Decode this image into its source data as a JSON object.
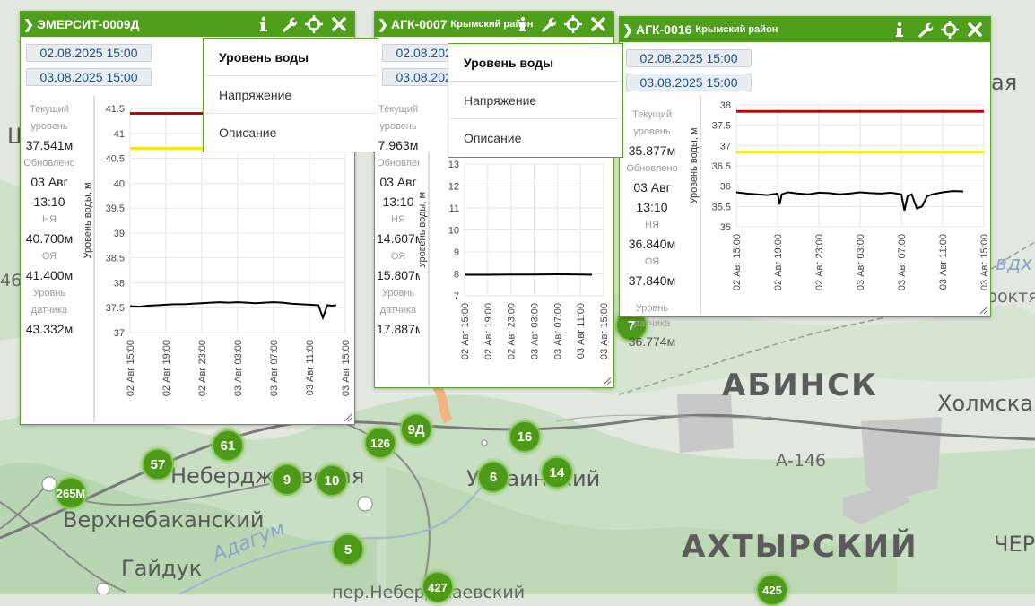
{
  "map": {
    "labels": [
      {
        "id": "abinsk",
        "text": "АБИНСК",
        "cls": "big"
      },
      {
        "id": "akhtyrsky",
        "text": "АХТЫРСКИЙ",
        "cls": "big"
      },
      {
        "id": "kholmskaya",
        "text": "Холмская",
        "cls": "mid"
      },
      {
        "id": "neberdzhaevskaya",
        "text": "Неберджаевская",
        "cls": "mid"
      },
      {
        "id": "verkhnebakansky",
        "text": "Верхнебаканский",
        "cls": "mid"
      },
      {
        "id": "gaiduk",
        "text": "Гайдук",
        "cls": "mid"
      },
      {
        "id": "adagum",
        "text": "Адагум",
        "cls": "river"
      },
      {
        "id": "a146",
        "text": "А-146",
        "cls": "road"
      },
      {
        "id": "ukrainsky",
        "text": "Украинский",
        "cls": "mid"
      },
      {
        "id": "cher",
        "text": "ЧЕР",
        "cls": "mid"
      },
      {
        "id": "proktya",
        "text": "роктя",
        "cls": "road"
      },
      {
        "id": "vdkh",
        "text": "вдх",
        "cls": "river"
      },
      {
        "id": "aya",
        "text": "ая",
        "cls": "mid"
      },
      {
        "id": "per",
        "text": "пер.Неберджаевский",
        "cls": "road"
      },
      {
        "id": "sh",
        "text": "Ш",
        "cls": "mid"
      },
      {
        "id": "num46",
        "text": "46",
        "cls": "road"
      }
    ],
    "clusters": [
      "61",
      "57",
      "9",
      "10",
      "126",
      "9Д",
      "16",
      "6",
      "14",
      "5",
      "427",
      "425",
      "265М",
      "7"
    ]
  },
  "panels": [
    {
      "id": "p1",
      "title": "ЭМЕРСИТ-0009Д",
      "subtitle": "",
      "date_from": "02.08.2025 15:00",
      "date_to": "03.08.2025 15:00",
      "info": [
        {
          "label": "Текущий уровень",
          "value": "37.541м"
        },
        {
          "label": "Обновлено",
          "value": "03 Авг 13:10"
        },
        {
          "label": "НЯ",
          "value": "40.700м"
        },
        {
          "label": "ОЯ",
          "value": "41.400м"
        },
        {
          "label": "Уровнь датчика",
          "value": "43.332м"
        }
      ]
    },
    {
      "id": "p2",
      "title": "АГК-0007",
      "subtitle": "Крымский район",
      "date_from": "02.08.2025 15:00",
      "date_to": "03.08.2025 15:00",
      "info": [
        {
          "label": "Текущий уровень",
          "value": "7.963м"
        },
        {
          "label": "Обновлено",
          "value": "03 Авг 13:10"
        },
        {
          "label": "НЯ",
          "value": "14.607м"
        },
        {
          "label": "ОЯ",
          "value": "15.807м"
        },
        {
          "label": "Уровнь датчика",
          "value": "17.887м"
        }
      ]
    },
    {
      "id": "p3",
      "title": "АГК-0016",
      "subtitle": "Крымский район",
      "date_from": "02.08.2025 15:00",
      "date_to": "03.08.2025 15:00",
      "info": [
        {
          "label": "Текущий уровень",
          "value": "35.877м"
        },
        {
          "label": "Обновлено",
          "value": "03 Авг 13:10"
        },
        {
          "label": "НЯ",
          "value": "36.840м"
        },
        {
          "label": "ОЯ",
          "value": "37.840м"
        },
        {
          "label": "Уровнь датчика",
          "value": "36.774м"
        }
      ]
    }
  ],
  "menus": [
    {
      "id": "m1",
      "items": [
        "Уровень воды",
        "Напряжение",
        "Описание"
      ],
      "active": "Уровень воды"
    },
    {
      "id": "m2",
      "items": [
        "Уровень воды",
        "Напряжение",
        "Описание"
      ],
      "active": "Уровень воды"
    }
  ],
  "colors": {
    "header": "#4f9e1c",
    "danger_line": "#cc0000",
    "warn_line": "#f5e51a",
    "series": "#000000",
    "cluster": "#4c9a17"
  },
  "icons": [
    "chevron-right-icon",
    "info-icon",
    "wrench-icon",
    "crosshair-icon",
    "close-icon",
    "resize-handle-icon"
  ],
  "chart_data": [
    {
      "type": "line",
      "panel": "p1",
      "ylabel": "Уровень воды, м",
      "ylim": [
        37,
        41.5
      ],
      "yticks": [
        "37",
        "37.5",
        "38",
        "38.5",
        "39",
        "39.5",
        "40",
        "40.5",
        "41",
        "41.5"
      ],
      "xticks": [
        "02 Авг 15:00",
        "02 Авг 19:00",
        "02 Авг 23:00",
        "03 Авг 03:00",
        "03 Авг 07:00",
        "03 Авг 11:00",
        "03 Авг 15:00"
      ],
      "hlines": [
        {
          "name": "ОЯ",
          "value": 41.4,
          "color": "#cc0000"
        },
        {
          "name": "НЯ",
          "value": 40.7,
          "color": "#f5e51a"
        }
      ],
      "series": [
        {
          "x": [
            0,
            1,
            2,
            3,
            4,
            5,
            6,
            7,
            8,
            9,
            10,
            11,
            12,
            13,
            14,
            15,
            16,
            17,
            18,
            19,
            20,
            21,
            21.5,
            22,
            22.5,
            23
          ],
          "values": [
            37.53,
            37.52,
            37.54,
            37.55,
            37.56,
            37.57,
            37.57,
            37.58,
            37.59,
            37.6,
            37.61,
            37.6,
            37.61,
            37.6,
            37.59,
            37.6,
            37.61,
            37.6,
            37.58,
            37.57,
            37.56,
            37.55,
            37.3,
            37.55,
            37.54,
            37.55
          ]
        }
      ]
    },
    {
      "type": "line",
      "panel": "p2",
      "ylabel": "Уровень воды, м",
      "ylim": [
        7,
        13
      ],
      "yticks": [
        "7",
        "8",
        "9",
        "10",
        "11",
        "12",
        "13"
      ],
      "xticks": [
        "02 Авг 15:00",
        "02 Авг 19:00",
        "02 Авг 23:00",
        "03 Авг 03:00",
        "03 Авг 07:00",
        "03 Авг 11:00",
        "03 Авг 15:00"
      ],
      "hlines": [],
      "series": [
        {
          "x": [
            0,
            4,
            8,
            12,
            16,
            20,
            22
          ],
          "values": [
            7.96,
            7.96,
            7.97,
            7.97,
            7.98,
            7.97,
            7.96
          ]
        }
      ]
    },
    {
      "type": "line",
      "panel": "p3",
      "ylabel": "Уровень воды, м",
      "ylim": [
        35,
        38
      ],
      "yticks": [
        "35",
        "35.5",
        "36",
        "36.5",
        "37",
        "37.5",
        "38"
      ],
      "xticks": [
        "02 Авг 15:00",
        "02 Авг 19:00",
        "02 Авг 23:00",
        "03 Авг 03:00",
        "03 Авг 07:00",
        "03 Авг 11:00",
        "03 Авг 15:00"
      ],
      "hlines": [
        {
          "name": "ОЯ",
          "value": 37.84,
          "color": "#cc0000"
        },
        {
          "name": "НЯ",
          "value": 36.84,
          "color": "#f5e51a"
        }
      ],
      "series": [
        {
          "x": [
            0,
            1,
            2,
            3,
            4,
            4.2,
            4.4,
            5,
            6,
            7,
            8,
            9,
            10,
            11,
            12,
            13,
            14,
            15,
            16,
            16.3,
            16.6,
            17,
            17.5,
            18,
            18.5,
            19,
            20,
            21,
            22
          ],
          "values": [
            35.85,
            35.82,
            35.8,
            35.78,
            35.82,
            35.55,
            35.8,
            35.85,
            35.82,
            35.8,
            35.84,
            35.83,
            35.8,
            35.82,
            35.85,
            35.83,
            35.82,
            35.84,
            35.8,
            35.4,
            35.75,
            35.8,
            35.45,
            35.5,
            35.75,
            35.8,
            35.85,
            35.88,
            35.87
          ]
        }
      ]
    }
  ]
}
